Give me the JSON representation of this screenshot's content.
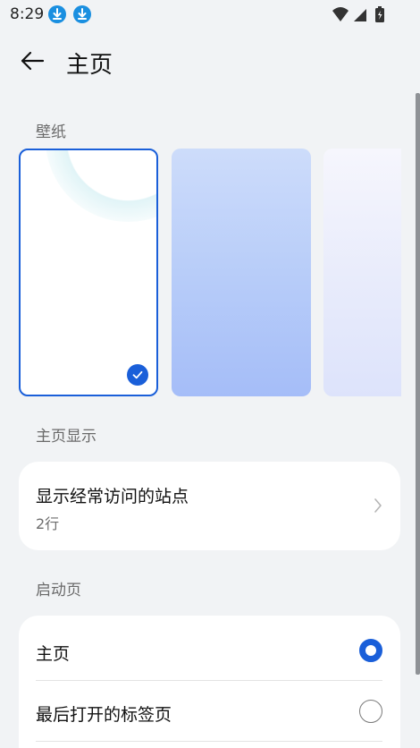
{
  "status_bar": {
    "time": "8:29"
  },
  "header": {
    "title": "主页"
  },
  "wallpaper_section": {
    "label": "壁纸",
    "items": [
      {
        "name": "white",
        "selected": true
      },
      {
        "name": "blue-gradient",
        "selected": false
      },
      {
        "name": "light-lavender",
        "selected": false
      }
    ]
  },
  "home_display_section": {
    "label": "主页显示",
    "frequent_sites": {
      "title": "显示经常访问的站点",
      "value": "2行"
    }
  },
  "startup_section": {
    "label": "启动页",
    "options": [
      {
        "label": "主页",
        "selected": true
      },
      {
        "label": "最后打开的标签页",
        "selected": false
      }
    ]
  },
  "colors": {
    "accent": "#1a5fd9",
    "background": "#f1f3f5",
    "card": "#ffffff"
  }
}
